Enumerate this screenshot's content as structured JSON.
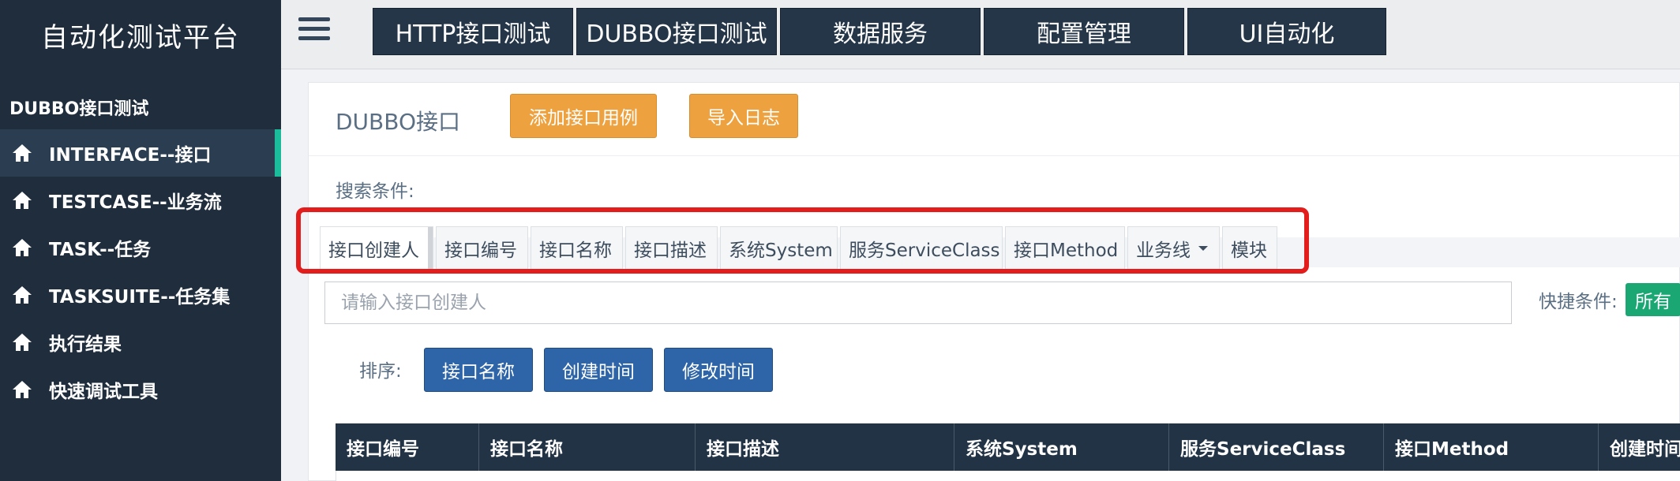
{
  "sidebar": {
    "brand": "自动化测试平台",
    "section_title": "DUBBO接口测试",
    "items": [
      {
        "label": "INTERFACE--接口",
        "icon": "home-icon"
      },
      {
        "label": "TESTCASE--业务流",
        "icon": "home-icon"
      },
      {
        "label": "TASK--任务",
        "icon": "home-icon"
      },
      {
        "label": "TASKSUITE--任务集",
        "icon": "home-icon"
      },
      {
        "label": "执行结果",
        "icon": "home-icon"
      },
      {
        "label": "快速调试工具",
        "icon": "home-icon"
      }
    ]
  },
  "topnav": {
    "menu_icon": "hamburger-icon",
    "items": [
      "HTTP接口测试",
      "DUBBO接口测试",
      "数据服务",
      "配置管理",
      "UI自动化"
    ]
  },
  "main": {
    "title": "DUBBO接口",
    "add_button": "添加接口用例",
    "import_button": "导入日志",
    "search_label": "搜索条件:",
    "tabs": [
      "接口创建人",
      "接口编号",
      "接口名称",
      "接口描述",
      "系统System",
      "服务ServiceClass",
      "接口Method",
      "业务线",
      "模块"
    ],
    "search_placeholder": "请输入接口创建人",
    "quick_label": "快捷条件:",
    "quick_badge": "所有",
    "sort_label": "排序:",
    "sort_buttons": [
      "接口名称",
      "创建时间",
      "修改时间"
    ],
    "table_headers": [
      "接口编号",
      "接口名称",
      "接口描述",
      "系统System",
      "服务ServiceClass",
      "接口Method",
      "创建时间"
    ]
  },
  "colors": {
    "sidebar_bg": "#1f2d3d",
    "active_indicator": "#1abc9c",
    "orange_button": "#eea23f",
    "blue_button": "#2e64a8",
    "quick_badge": "#1aa774",
    "highlight": "#e31c1c"
  }
}
